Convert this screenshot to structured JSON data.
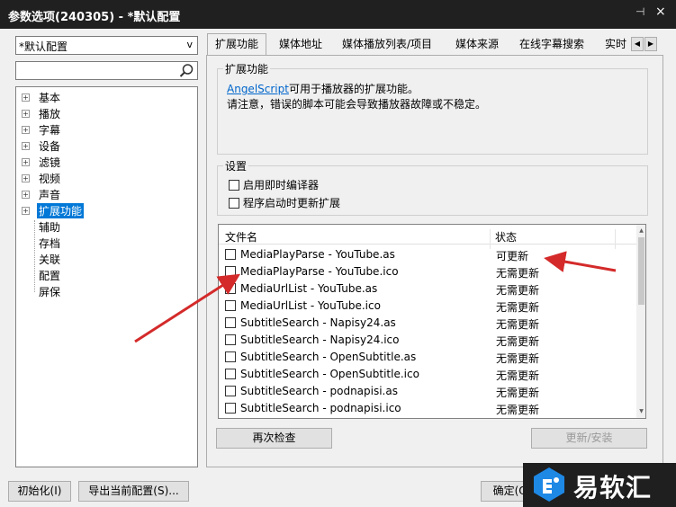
{
  "window": {
    "title": "参数选项(240305) - *默认配置",
    "pin_glyph": "⊣",
    "close_glyph": "×"
  },
  "sidebar": {
    "profile_value": "*默认配置",
    "search_value": "",
    "tree": [
      {
        "label": "基本",
        "expandable": true
      },
      {
        "label": "播放",
        "expandable": true
      },
      {
        "label": "字幕",
        "expandable": true
      },
      {
        "label": "设备",
        "expandable": true
      },
      {
        "label": "滤镜",
        "expandable": true
      },
      {
        "label": "视频",
        "expandable": true
      },
      {
        "label": "声音",
        "expandable": true
      },
      {
        "label": "扩展功能",
        "expandable": true,
        "selected": true
      },
      {
        "label": "辅助",
        "expandable": false
      },
      {
        "label": "存档",
        "expandable": false
      },
      {
        "label": "关联",
        "expandable": false
      },
      {
        "label": "配置",
        "expandable": false
      },
      {
        "label": "屏保",
        "expandable": false
      }
    ]
  },
  "tabs": [
    {
      "label": "扩展功能",
      "active": true
    },
    {
      "label": "媒体地址"
    },
    {
      "label": "媒体播放列表/项目"
    },
    {
      "label": "媒体来源"
    },
    {
      "label": "在线字幕搜索"
    },
    {
      "label": "实时"
    }
  ],
  "extensions": {
    "group_title": "扩展功能",
    "link_text": "AngelScript",
    "desc_line1": "可用于播放器的扩展功能。",
    "desc_line2": "请注意，错误的脚本可能会导致播放器故障或不稳定。"
  },
  "settings": {
    "group_title": "设置",
    "options": [
      {
        "label": "启用即时编译器",
        "checked": false
      },
      {
        "label": "程序启动时更新扩展",
        "checked": false
      }
    ]
  },
  "file_list": {
    "col_name": "文件名",
    "col_status": "状态",
    "rows": [
      {
        "name": "MediaPlayParse - YouTube.as",
        "status": "可更新"
      },
      {
        "name": "MediaPlayParse - YouTube.ico",
        "status": "无需更新"
      },
      {
        "name": "MediaUrlList - YouTube.as",
        "status": "无需更新"
      },
      {
        "name": "MediaUrlList - YouTube.ico",
        "status": "无需更新"
      },
      {
        "name": "SubtitleSearch - Napisy24.as",
        "status": "无需更新"
      },
      {
        "name": "SubtitleSearch - Napisy24.ico",
        "status": "无需更新"
      },
      {
        "name": "SubtitleSearch - OpenSubtitle.as",
        "status": "无需更新"
      },
      {
        "name": "SubtitleSearch - OpenSubtitle.ico",
        "status": "无需更新"
      },
      {
        "name": "SubtitleSearch - podnapisi.as",
        "status": "无需更新"
      },
      {
        "name": "SubtitleSearch - podnapisi.ico",
        "status": "无需更新"
      }
    ]
  },
  "buttons": {
    "recheck": "再次检查",
    "update_install": "更新/安装",
    "initialize": "初始化(I)",
    "export": "导出当前配置(S)...",
    "ok": "确定(O)"
  },
  "watermark": {
    "text": "易软汇"
  },
  "colors": {
    "selection": "#0078d7",
    "titlebar": "#202020",
    "annotation_arrow": "#d42a2a"
  }
}
